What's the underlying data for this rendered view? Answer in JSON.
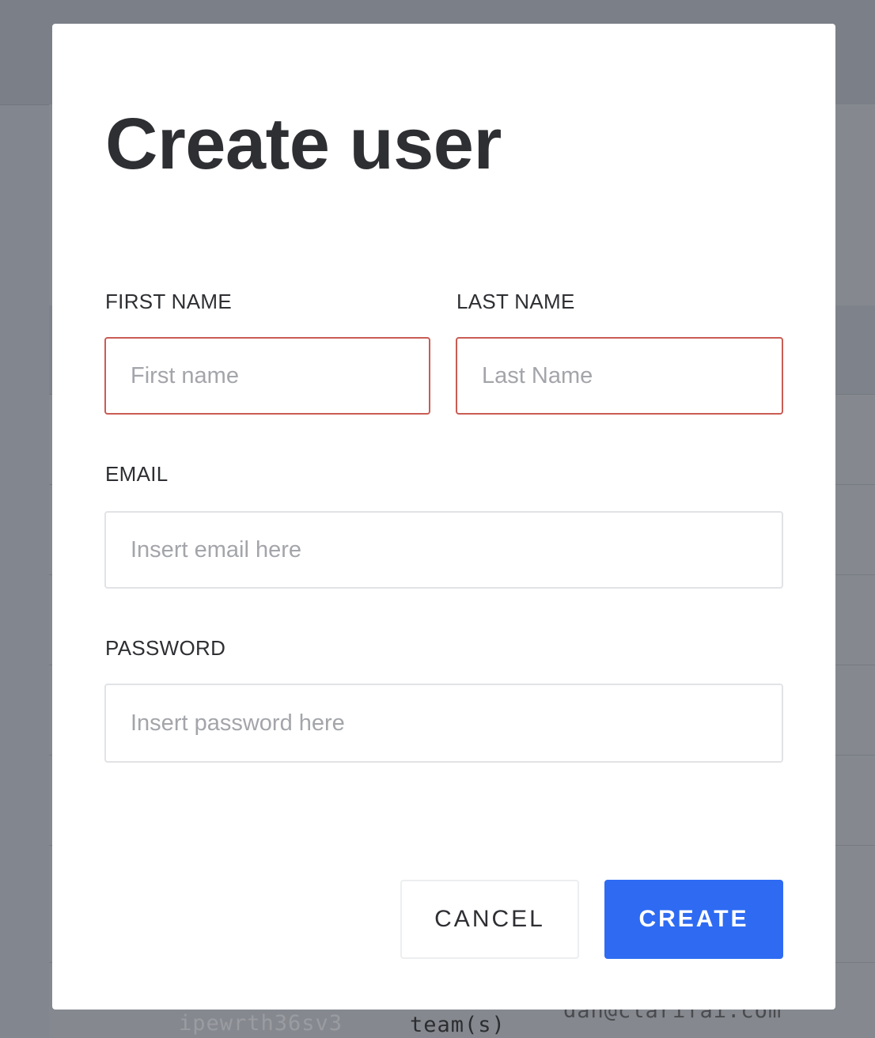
{
  "background": {
    "row": {
      "id": "ipewrth36sv3",
      "team": "team(s)",
      "email": "dan@clarifai.com"
    }
  },
  "modal": {
    "title": "Create user",
    "fields": {
      "first_name": {
        "label": "FIRST NAME",
        "placeholder": "First name",
        "value": "",
        "state": "error"
      },
      "last_name": {
        "label": "LAST NAME",
        "placeholder": "Last Name",
        "value": "",
        "state": "error"
      },
      "email": {
        "label": "EMAIL",
        "placeholder": "Insert email here",
        "value": ""
      },
      "password": {
        "label": "PASSWORD",
        "placeholder": "Insert password here",
        "value": ""
      }
    },
    "buttons": {
      "cancel": "CANCEL",
      "create": "CREATE"
    }
  },
  "colors": {
    "accent": "#2e6bf2",
    "error_border": "#c95c54",
    "overlay": "#82868e"
  }
}
